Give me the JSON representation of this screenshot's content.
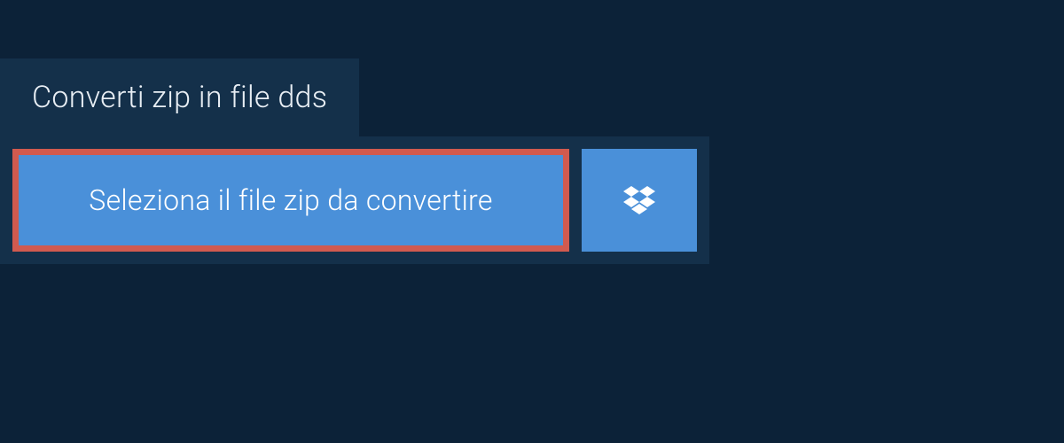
{
  "header": {
    "title": "Converti zip in file dds"
  },
  "upload": {
    "select_label": "Seleziona il file zip da convertire",
    "dropbox_icon": "dropbox"
  },
  "colors": {
    "bg_dark": "#0c2238",
    "bg_panel": "#14304a",
    "button_blue": "#4a90d9",
    "button_border": "#d15a4f",
    "text_light": "#e8eef4",
    "text_white": "#ffffff"
  }
}
